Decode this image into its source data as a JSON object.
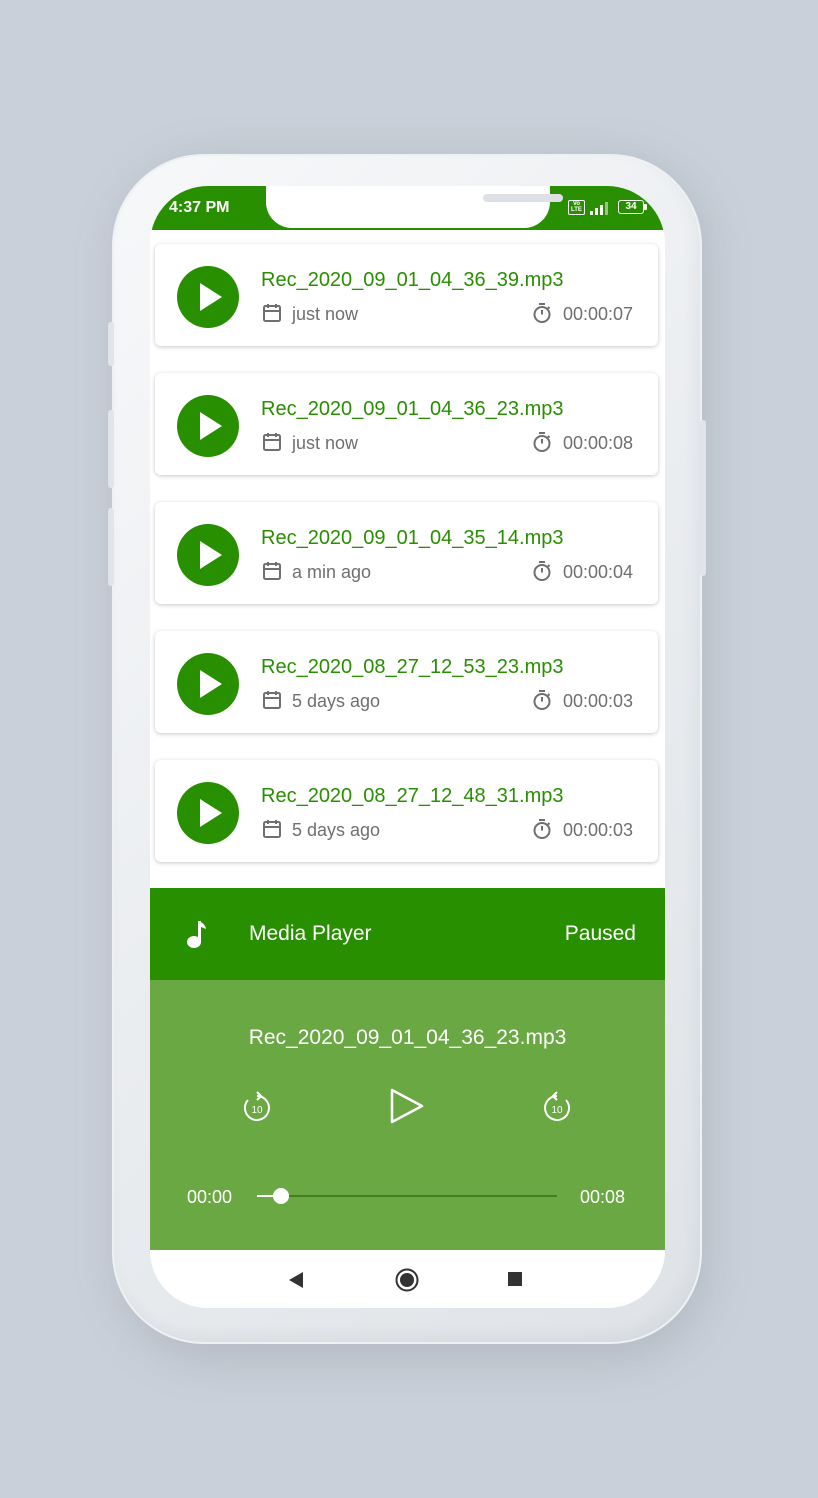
{
  "status_bar": {
    "time": "4:37 PM",
    "battery": "34",
    "volte": "Vo LTE"
  },
  "recordings": [
    {
      "name": "Rec_2020_09_01_04_36_39.mp3",
      "date": "just now",
      "duration": "00:00:07"
    },
    {
      "name": "Rec_2020_09_01_04_36_23.mp3",
      "date": "just now",
      "duration": "00:00:08"
    },
    {
      "name": "Rec_2020_09_01_04_35_14.mp3",
      "date": "a min ago",
      "duration": "00:00:04"
    },
    {
      "name": "Rec_2020_08_27_12_53_23.mp3",
      "date": "5 days ago",
      "duration": "00:00:03"
    },
    {
      "name": "Rec_2020_08_27_12_48_31.mp3",
      "date": "5 days ago",
      "duration": "00:00:03"
    }
  ],
  "player": {
    "title": "Media Player",
    "status": "Paused",
    "now_playing": "Rec_2020_09_01_04_36_23.mp3",
    "current_time": "00:00",
    "total_time": "00:08",
    "progress": 0.08,
    "rewind_seconds": "10",
    "forward_seconds": "10"
  },
  "colors": {
    "primary": "#288f00",
    "player_body": "#6aa844",
    "secondary_text": "#6f6f6f"
  },
  "icons": {
    "card_play": "play-icon",
    "date": "calendar-icon",
    "duration": "timer-icon",
    "player": "music-note-icon",
    "rewind": "replay-10-icon",
    "play": "play-outline-icon",
    "forward": "forward-10-icon",
    "nav_back": "back-icon",
    "nav_home": "home-icon",
    "nav_recent": "recents-icon"
  }
}
